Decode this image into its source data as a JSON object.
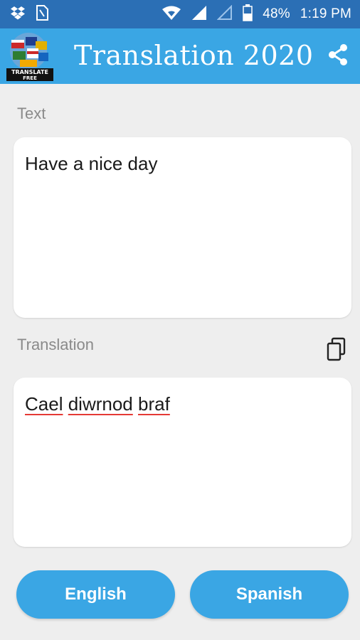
{
  "status_bar": {
    "battery_percent": "48%",
    "time": "1:19 PM",
    "icons": [
      "dropbox-icon",
      "sim-card-icon",
      "wifi-icon",
      "signal-icon",
      "signal-empty-icon",
      "battery-icon"
    ]
  },
  "app_bar": {
    "title": "Translation 2020",
    "logo_caption": "TRANSLATE FREE",
    "share_icon": "share-icon"
  },
  "source": {
    "label": "Text",
    "value": "Have a nice day"
  },
  "result": {
    "label": "Translation",
    "words": [
      "Cael",
      "diwrnod",
      "braf"
    ],
    "copy_icon": "copy-icon"
  },
  "buttons": {
    "source_language": "English",
    "target_language": "Spanish"
  },
  "colors": {
    "status_bar": "#2b6fb5",
    "app_bar": "#3aa6e4",
    "background": "#eeeeee",
    "button": "#3aa6e4",
    "spellcheck_underline": "#e53935"
  }
}
